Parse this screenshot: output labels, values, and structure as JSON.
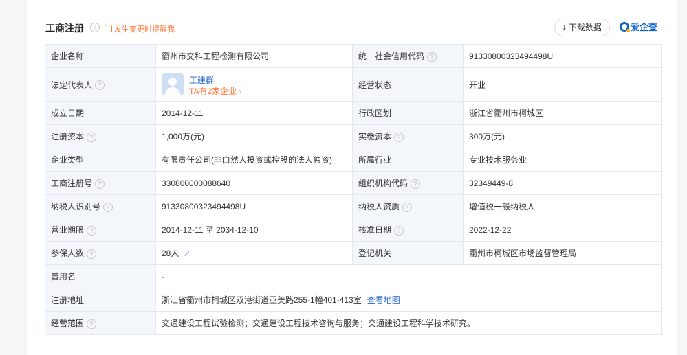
{
  "header": {
    "title": "工商注册",
    "alert": "发生变更时提醒我",
    "download_label": "下载数据",
    "brand": "爱企查"
  },
  "rows": [
    {
      "l1": "企业名称",
      "v1": "衢州市交科工程检测有限公司",
      "l2": "统一社会信用代码",
      "v2": "91330800323494498U"
    },
    {
      "l1": "法定代表人",
      "v1": "",
      "l2": "经营状态",
      "v2": "开业"
    },
    {
      "l1": "成立日期",
      "v1": "2014-12-11",
      "l2": "行政区划",
      "v2": "浙江省衢州市柯城区"
    },
    {
      "l1": "注册资本",
      "v1": "1,000万(元)",
      "l2": "实缴资本",
      "v2": "300万(元)"
    },
    {
      "l1": "企业类型",
      "v1": "有限责任公司(非自然人投资或控股的法人独资)",
      "l2": "所属行业",
      "v2": "专业技术服务业"
    },
    {
      "l1": "工商注册号",
      "v1": "330800000088640",
      "l2": "组织机构代码",
      "v2": "32349449-8"
    },
    {
      "l1": "纳税人识别号",
      "v1": "91330800323494498U",
      "l2": "纳税人资质",
      "v2": "增值税一般纳税人"
    },
    {
      "l1": "营业期限",
      "v1": "2014-12-11 至 2034-12-10",
      "l2": "核准日期",
      "v2": "2022-12-22"
    },
    {
      "l1": "参保人数",
      "v1": "28人",
      "l2": "登记机关",
      "v2": "衢州市柯城区市场监督管理局"
    },
    {
      "l1": "曾用名",
      "v1": "-"
    },
    {
      "l1": "注册地址",
      "v1": "浙江省衢州市柯城区双港街道亚美路255-1幢401-413室",
      "link": "查看地图"
    },
    {
      "l1": "经营范围",
      "v1": "交通建设工程试验检测；交通建设工程技术咨询与服务；交通建设工程科学技术研究。"
    }
  ],
  "legal_rep": {
    "name": "王建群",
    "companies": "TA有2家企业 ›"
  },
  "icons": {
    "help": "question-circle-icon",
    "download": "download-icon",
    "bell": "bell-icon",
    "chart": "trend-chart-icon"
  },
  "colors": {
    "accent": "#1f63c6",
    "warning": "#ff7a3d",
    "label_bg": "#f3f6fa",
    "border": "#e4e8ee"
  }
}
